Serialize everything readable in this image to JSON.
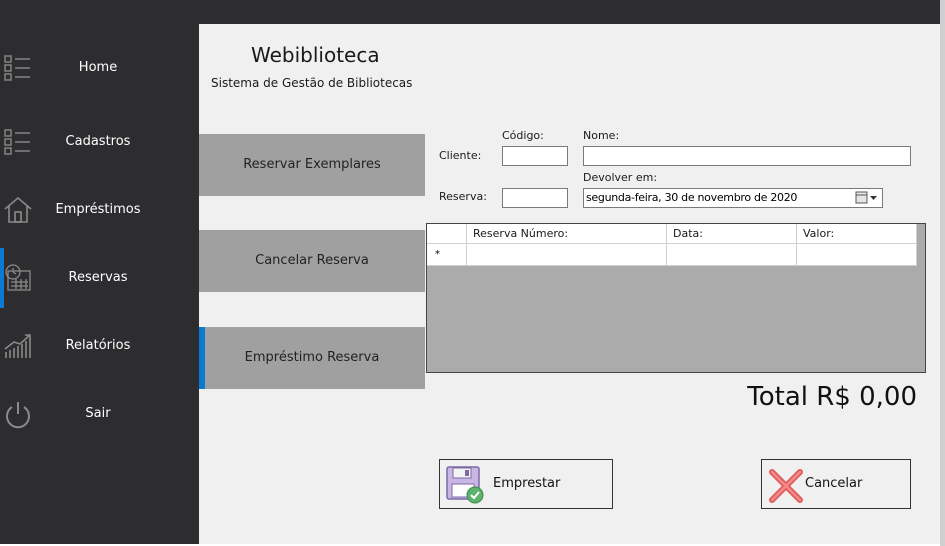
{
  "header": {
    "title": "Webiblioteca",
    "subtitle": "Sistema de Gestão de Bibliotecas"
  },
  "sidebar": {
    "items": [
      {
        "label": "Home",
        "icon": "list-icon"
      },
      {
        "label": "Cadastros",
        "icon": "list-icon"
      },
      {
        "label": "Empréstimos",
        "icon": "house-icon"
      },
      {
        "label": "Reservas",
        "icon": "calendar-clock-icon",
        "active": true
      },
      {
        "label": "Relatórios",
        "icon": "chart-up-icon"
      },
      {
        "label": "Sair",
        "icon": "power-icon"
      }
    ],
    "accent_color": "#0a7bd1"
  },
  "side_buttons": [
    {
      "label": "Reservar Exemplares"
    },
    {
      "label": "Cancelar Reserva"
    },
    {
      "label": "Empréstimo Reserva",
      "active": true
    }
  ],
  "form": {
    "cliente_label": "Cliente:",
    "codigo_label": "Código:",
    "nome_label": "Nome:",
    "reserva_label": "Reserva:",
    "devolver_label": "Devolver em:",
    "codigo_value": "",
    "nome_value": "",
    "reserva_value": "",
    "devolver_value": "segunda-feira, 30 de novembro de 2020"
  },
  "grid": {
    "columns": [
      "Reserva Número:",
      "Data:",
      "Valor:"
    ],
    "new_row_marker": "*"
  },
  "total": "Total R$ 0,00",
  "actions": {
    "emprestar_label": "Emprestar",
    "cancelar_label": "Cancelar"
  }
}
